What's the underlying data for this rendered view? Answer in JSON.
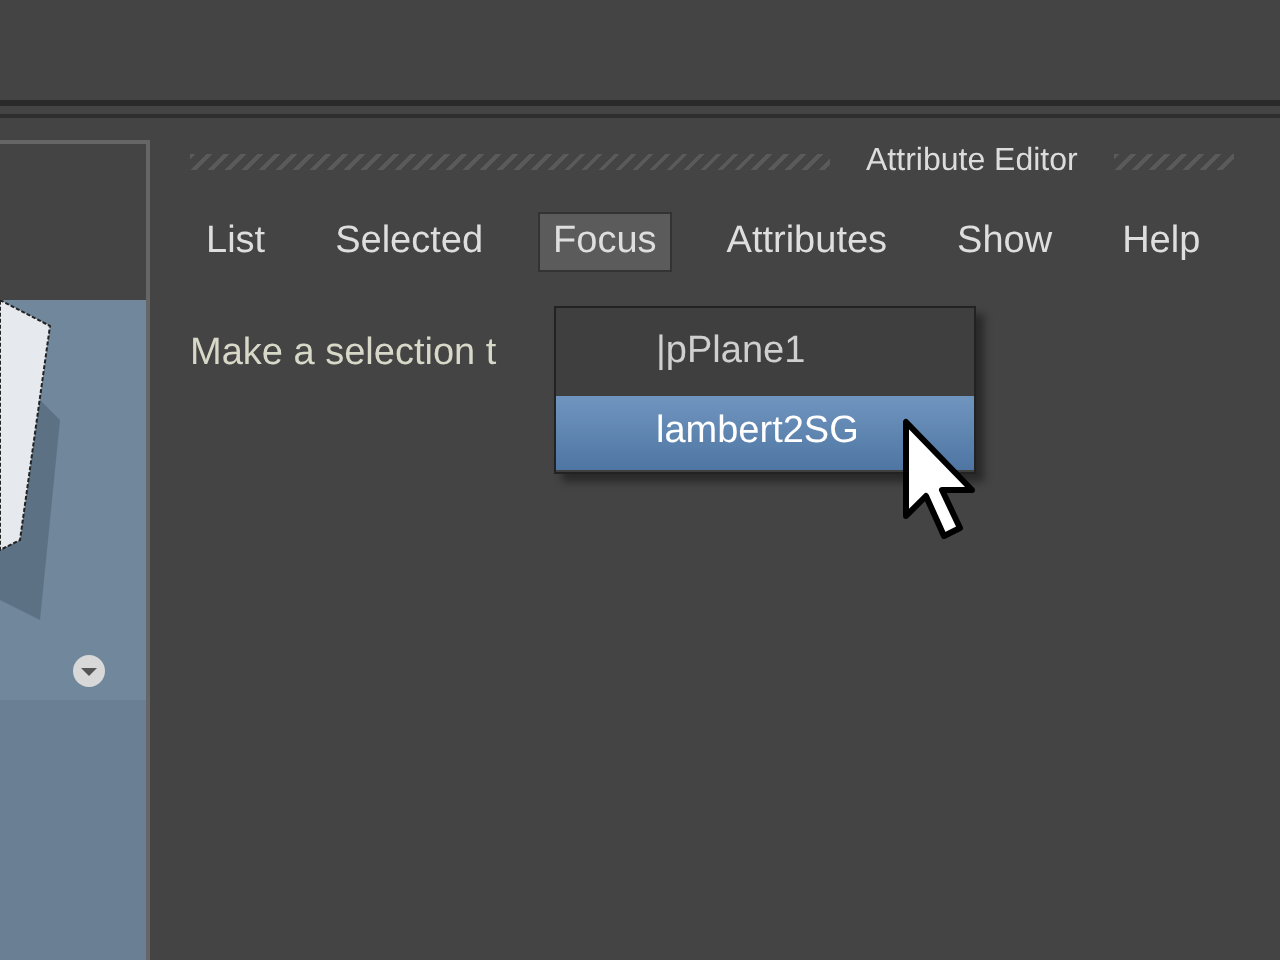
{
  "panel": {
    "title": "Attribute Editor"
  },
  "menu_bar": [
    {
      "label": "List",
      "selected": false
    },
    {
      "label": "Selected",
      "selected": false
    },
    {
      "label": "Focus",
      "selected": true
    },
    {
      "label": "Attributes",
      "selected": false
    },
    {
      "label": "Show",
      "selected": false
    },
    {
      "label": "Help",
      "selected": false
    }
  ],
  "message": "Make a selection t",
  "dropdown": [
    {
      "label": "|pPlane1",
      "selected": false
    },
    {
      "label": "lambert2SG",
      "selected": true
    }
  ]
}
